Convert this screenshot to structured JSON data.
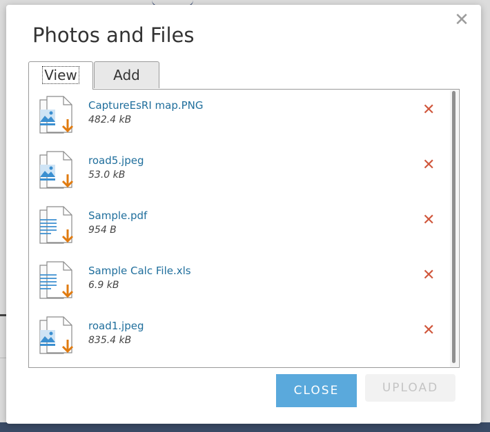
{
  "dialog": {
    "title": "Photos and Files",
    "close_icon": "close-icon"
  },
  "tabs": [
    {
      "label": "View",
      "active": true
    },
    {
      "label": "Add",
      "active": false
    }
  ],
  "files": [
    {
      "name": "CaptureEsRI map.PNG",
      "size": "482.4 kB",
      "icon": "image-file-download-icon"
    },
    {
      "name": "road5.jpeg",
      "size": "53.0 kB",
      "icon": "image-file-download-icon"
    },
    {
      "name": "Sample.pdf",
      "size": "954 B",
      "icon": "document-file-download-icon"
    },
    {
      "name": "Sample Calc File.xls",
      "size": "6.9 kB",
      "icon": "document-file-download-icon"
    },
    {
      "name": "road1.jpeg",
      "size": "835.4 kB",
      "icon": "image-file-download-icon"
    }
  ],
  "delete_icon": "delete-icon",
  "buttons": {
    "close": "CLOSE",
    "upload": "UPLOAD"
  },
  "colors": {
    "accent": "#5aa9dc",
    "link": "#1f6e9c",
    "delete": "#d0573c",
    "download_arrow": "#e07b10",
    "icon_blue": "#3b8fd0"
  }
}
